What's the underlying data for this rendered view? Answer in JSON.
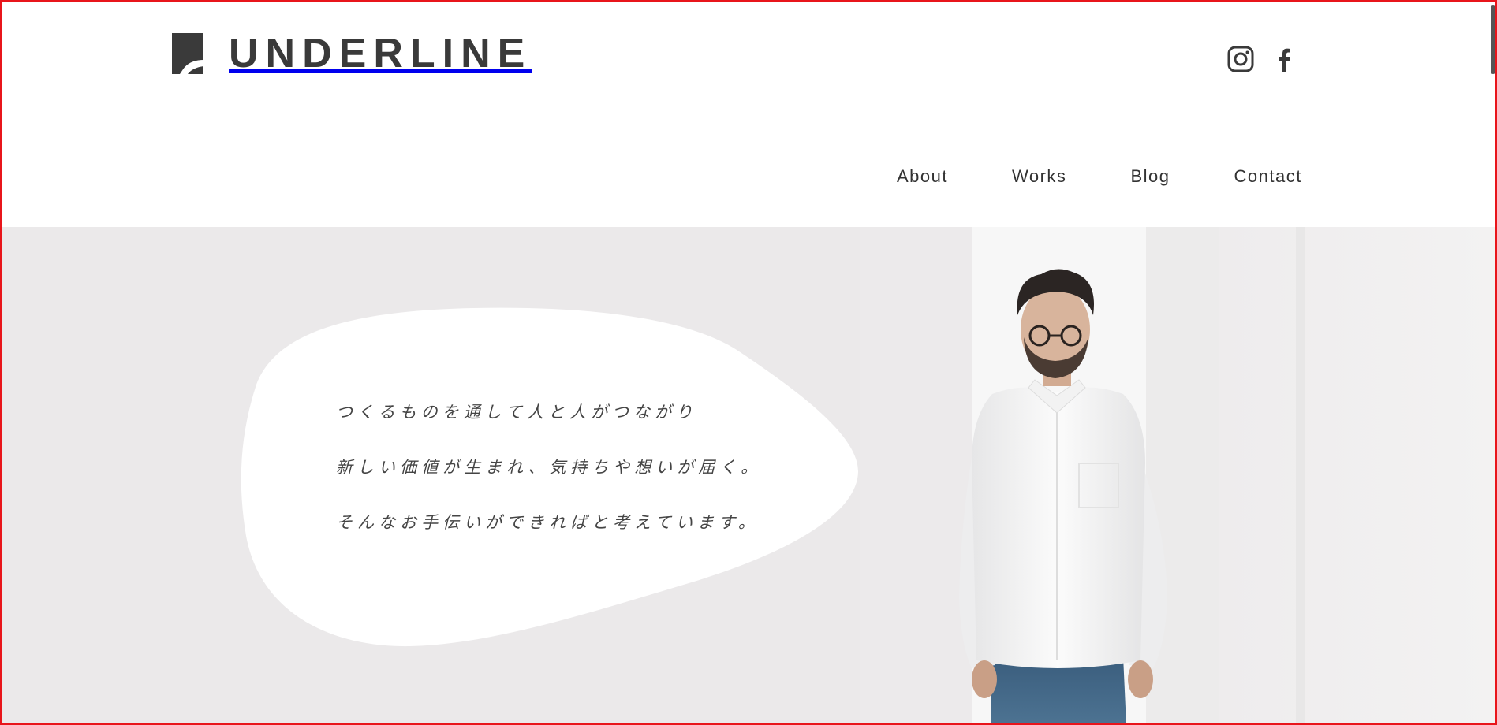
{
  "brand": {
    "name": "UNDERLINE",
    "color": "#3a3a3a"
  },
  "social": [
    {
      "icon": "instagram-icon",
      "label": "Instagram"
    },
    {
      "icon": "facebook-icon",
      "label": "Facebook"
    }
  ],
  "nav": {
    "items": [
      "About",
      "Works",
      "Blog",
      "Contact"
    ]
  },
  "hero": {
    "lines": [
      "つくるものを通して人と人がつながり",
      "新しい価値が生まれ、気持ちや想いが届く。",
      "そんなお手伝いができればと考えています。"
    ],
    "background_color": "#ebe9ea",
    "photo_icon": "person-photo"
  },
  "colors": {
    "frame": "#e8151b",
    "text": "#333333"
  }
}
